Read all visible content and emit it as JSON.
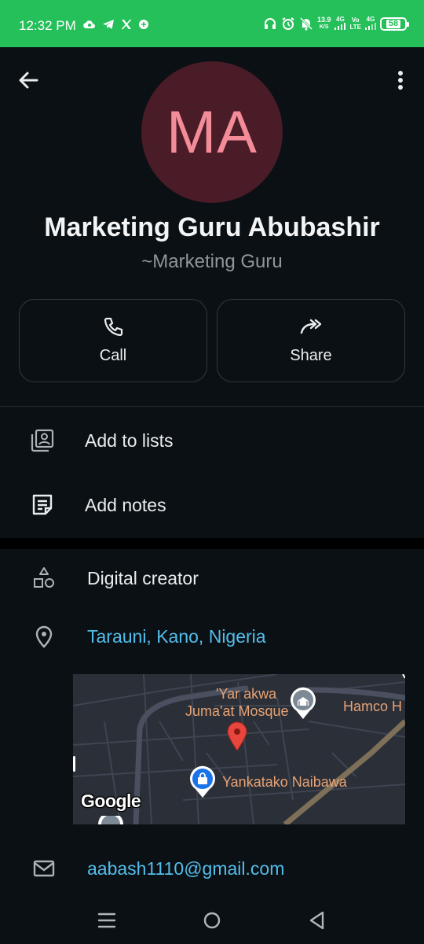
{
  "status_bar": {
    "time": "12:32 PM",
    "left_icons": [
      "cloud-icon",
      "telegram-icon",
      "x-icon",
      "browser-icon"
    ],
    "speed_value": "13.9",
    "speed_unit": "K/S",
    "net1": "4G",
    "net2_top": "Vo",
    "net2_bottom": "LTE",
    "net3": "4G",
    "battery": "58"
  },
  "contact": {
    "initials": "MA",
    "name": "Marketing Guru Abubashir",
    "subtitle": "~Marketing Guru"
  },
  "actions": {
    "call_label": "Call",
    "share_label": "Share"
  },
  "options": {
    "add_to_lists": "Add to lists",
    "add_notes": "Add notes"
  },
  "business": {
    "category": "Digital creator",
    "location": "Tarauni, Kano, Nigeria",
    "email": "aabash1110@gmail.com"
  },
  "map": {
    "label_mosque_line1": "'Yar akwa",
    "label_mosque_line2": "Juma'at Mosque",
    "label_hamco": "Hamco H",
    "label_yankatako": "Yankatako Naibawa",
    "google": "Google"
  },
  "colors": {
    "status_bar": "#25c05a",
    "background": "#0b1014",
    "avatar_bg": "#4a1c27",
    "avatar_text": "#f48b98",
    "link": "#53bdeb"
  }
}
